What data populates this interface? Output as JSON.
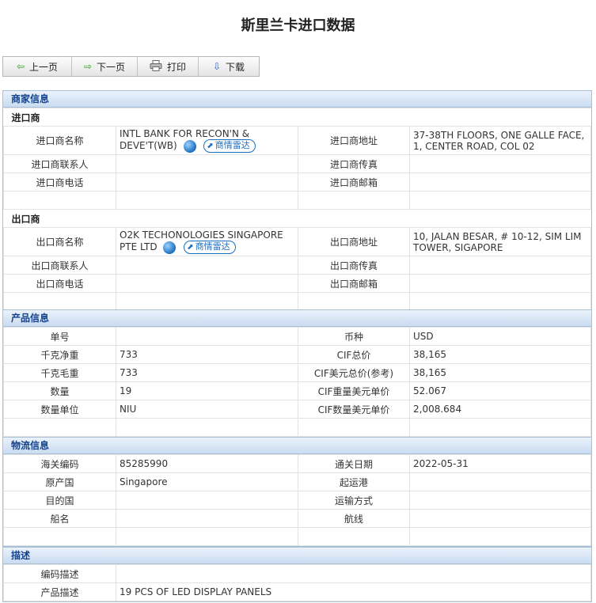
{
  "page": {
    "title": "斯里兰卡进口数据"
  },
  "toolbar": {
    "prev": "上一页",
    "next": "下一页",
    "print": "打印",
    "download": "下载"
  },
  "merchant": {
    "section_title": "商家信息",
    "radar_label": "商情雷达",
    "importer": {
      "heading": "进口商",
      "name_label": "进口商名称",
      "name": "INTL BANK FOR RECON'N & DEVE'T(WB)",
      "address_label": "进口商地址",
      "address": "37-38TH FLOORS, ONE GALLE FACE, 1, CENTER ROAD, COL 02",
      "contact_label": "进口商联系人",
      "contact": "",
      "fax_label": "进口商传真",
      "fax": "",
      "phone_label": "进口商电话",
      "phone": "",
      "email_label": "进口商邮箱",
      "email": ""
    },
    "exporter": {
      "heading": "出口商",
      "name_label": "出口商名称",
      "name": "O2K TECHONOLOGIES SINGAPORE PTE LTD",
      "address_label": "出口商地址",
      "address": "10, JALAN BESAR, # 10-12, SIM LIM TOWER, SIGAPORE",
      "contact_label": "出口商联系人",
      "contact": "",
      "fax_label": "出口商传真",
      "fax": "",
      "phone_label": "出口商电话",
      "phone": "",
      "email_label": "出口商邮箱",
      "email": ""
    }
  },
  "product": {
    "section_title": "产品信息",
    "rows": [
      {
        "l1": "单号",
        "v1": "",
        "l2": "币种",
        "v2": "USD"
      },
      {
        "l1": "千克净重",
        "v1": "733",
        "l2": "CIF总价",
        "v2": "38,165"
      },
      {
        "l1": "千克毛重",
        "v1": "733",
        "l2": "CIF美元总价(参考)",
        "v2": "38,165"
      },
      {
        "l1": "数量",
        "v1": "19",
        "l2": "CIF重量美元单价",
        "v2": "52.067"
      },
      {
        "l1": "数量单位",
        "v1": "NIU",
        "l2": "CIF数量美元单价",
        "v2": "2,008.684"
      }
    ]
  },
  "logistics": {
    "section_title": "物流信息",
    "rows": [
      {
        "l1": "海关编码",
        "v1": "85285990",
        "l2": "通关日期",
        "v2": "2022-05-31"
      },
      {
        "l1": "原产国",
        "v1": "Singapore",
        "l2": "起运港",
        "v2": ""
      },
      {
        "l1": "目的国",
        "v1": "",
        "l2": "运输方式",
        "v2": ""
      },
      {
        "l1": "船名",
        "v1": "",
        "l2": "航线",
        "v2": ""
      }
    ]
  },
  "description": {
    "section_title": "描述",
    "code_desc_label": "编码描述",
    "code_desc": "",
    "product_desc_label": "产品描述",
    "product_desc": "19 PCS OF LED DISPLAY PANELS"
  },
  "colors": {
    "header_text": "#15428b",
    "panel_border": "#a9bfd6",
    "link": "#1a6fc0",
    "prev_icon": "#3a9b2d",
    "next_icon": "#3a9b2d",
    "download_icon": "#2a64c4"
  },
  "icons": {
    "prev": "arrow-left-icon",
    "next": "arrow-right-icon",
    "print": "printer-icon",
    "download": "arrow-down-icon",
    "globe": "globe-icon",
    "radar": "radar-icon"
  }
}
